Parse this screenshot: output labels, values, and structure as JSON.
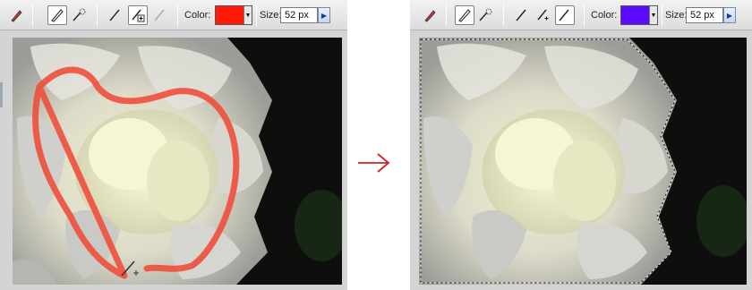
{
  "icons": {
    "brush_tool": "brush-icon",
    "brush_mode": "brush-icon",
    "impressionist_brush": "impressionist-brush-icon",
    "pencil": "pencil-icon",
    "add_to_selection": "add-brush-icon",
    "subtract_from_selection": "subtract-brush-icon",
    "cursor": "brush-cursor-icon",
    "transition_arrow": "arrow-right-icon"
  },
  "left_panel": {
    "color_label": "Color:",
    "color_value": "#ff1a0a",
    "size_label": "Size:",
    "size_value": "52 px"
  },
  "right_panel": {
    "color_label": "Color:",
    "color_value": "#5a0aff",
    "size_label": "Size:",
    "size_value": "52 px"
  },
  "colors": {
    "stroke": "#f04a38",
    "arrow": "#d42020",
    "selection_border": "#111111"
  }
}
